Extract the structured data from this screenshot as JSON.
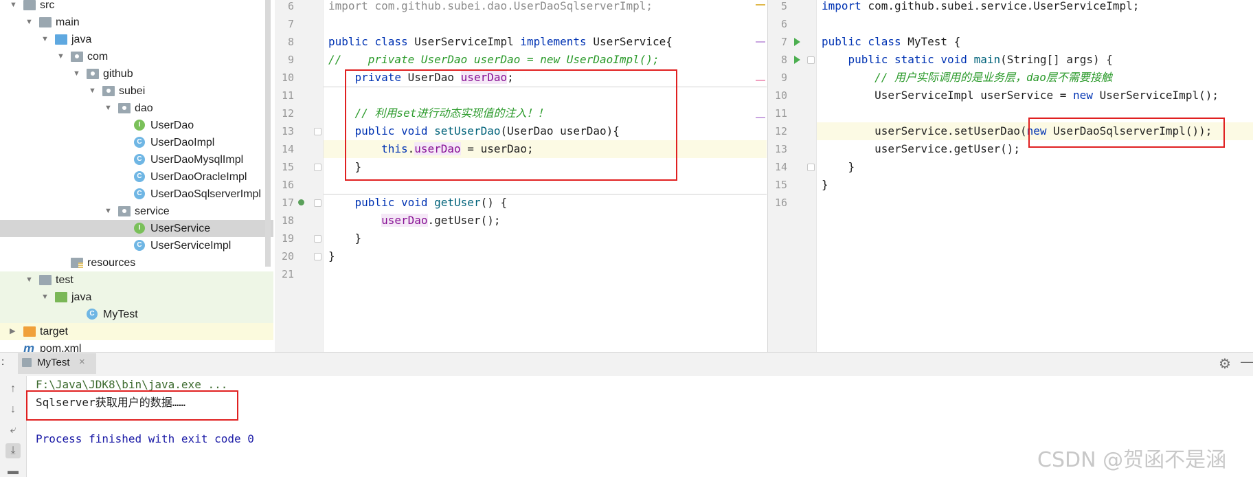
{
  "project_tree": {
    "items": [
      {
        "label": "src",
        "depth": 0,
        "icon": "folder-gray",
        "arrow": "expanded"
      },
      {
        "label": "main",
        "depth": 1,
        "icon": "folder-gray",
        "arrow": "expanded"
      },
      {
        "label": "java",
        "depth": 2,
        "icon": "folder-blue",
        "arrow": "expanded"
      },
      {
        "label": "com",
        "depth": 3,
        "icon": "folder-pkg",
        "arrow": "expanded"
      },
      {
        "label": "github",
        "depth": 4,
        "icon": "folder-pkg",
        "arrow": "expanded"
      },
      {
        "label": "subei",
        "depth": 5,
        "icon": "folder-pkg",
        "arrow": "expanded"
      },
      {
        "label": "dao",
        "depth": 6,
        "icon": "folder-pkg",
        "arrow": "expanded"
      },
      {
        "label": "UserDao",
        "depth": 7,
        "icon": "interface-icon",
        "badge": "I"
      },
      {
        "label": "UserDaoImpl",
        "depth": 7,
        "icon": "class-icon",
        "badge": "C"
      },
      {
        "label": "UserDaoMysqlImpl",
        "depth": 7,
        "icon": "class-icon",
        "badge": "C"
      },
      {
        "label": "UserDaoOracleImpl",
        "depth": 7,
        "icon": "class-icon",
        "badge": "C"
      },
      {
        "label": "UserDaoSqlserverImpl",
        "depth": 7,
        "icon": "class-icon",
        "badge": "C"
      },
      {
        "label": "service",
        "depth": 6,
        "icon": "folder-pkg",
        "arrow": "expanded"
      },
      {
        "label": "UserService",
        "depth": 7,
        "icon": "interface-icon",
        "badge": "I",
        "selected": true
      },
      {
        "label": "UserServiceImpl",
        "depth": 7,
        "icon": "class-icon",
        "badge": "C"
      },
      {
        "label": "resources",
        "depth": 3,
        "icon": "folder-res"
      },
      {
        "label": "test",
        "depth": 1,
        "icon": "folder-gray",
        "arrow": "expanded"
      },
      {
        "label": "java",
        "depth": 2,
        "icon": "folder-green",
        "arrow": "expanded"
      },
      {
        "label": "MyTest",
        "depth": 4,
        "icon": "test-class-icon",
        "badge": "C"
      },
      {
        "label": "target",
        "depth": 0,
        "icon": "folder-orange",
        "arrow": "collapsed"
      },
      {
        "label": "pom.xml",
        "depth": 0,
        "icon": "maven-icon",
        "badge": "m"
      }
    ]
  },
  "left_editor": {
    "lines": [
      {
        "n": "6",
        "html": "<span class=\"cm\">import com.github.subei.dao.UserDaoSqlserverImpl;</span>"
      },
      {
        "n": "7",
        "html": ""
      },
      {
        "n": "8",
        "html": "<span class=\"kw\">public class</span> UserServiceImpl <span class=\"kw\">implements</span> UserService{"
      },
      {
        "n": "9",
        "html": "<span class=\"gcm\">//    private UserDao userDao = new UserDaoImpl();</span>"
      },
      {
        "n": "10",
        "html": "    <span class=\"kw\">private</span> UserDao <span class=\"fld\">userDao</span>;"
      },
      {
        "n": "11",
        "html": ""
      },
      {
        "n": "12",
        "html": "    <span class=\"gcm\">// 利用set进行动态实现值的注入！！</span>"
      },
      {
        "n": "13",
        "html": "    <span class=\"kw\">public void</span> <span class=\"mth\">setUserDao</span>(UserDao userDao){"
      },
      {
        "n": "14",
        "html": "        <span class=\"kw\">this</span>.<span class=\"fld\">userDao</span> = userDao;"
      },
      {
        "n": "15",
        "html": "    }"
      },
      {
        "n": "16",
        "html": ""
      },
      {
        "n": "17",
        "html": "    <span class=\"kw\">public void</span> <span class=\"mth\">getUser</span>() {"
      },
      {
        "n": "18",
        "html": "        <span class=\"fld\">userDao</span>.getUser();"
      },
      {
        "n": "19",
        "html": "    }"
      },
      {
        "n": "20",
        "html": "}"
      },
      {
        "n": "21",
        "html": ""
      }
    ]
  },
  "right_editor": {
    "lines": [
      {
        "n": "5",
        "html": "<span class=\"kw\">import</span> com.github.subei.service.UserServiceImpl;"
      },
      {
        "n": "6",
        "html": ""
      },
      {
        "n": "7",
        "html": "<span class=\"kw\">public class</span> MyTest {"
      },
      {
        "n": "8",
        "html": "    <span class=\"kw\">public static void</span> <span class=\"mth\">main</span>(String[] args) {"
      },
      {
        "n": "9",
        "html": "        <span class=\"gcm\">// 用户实际调用的是业务层，dao层不需要接触</span>"
      },
      {
        "n": "10",
        "html": "        UserServiceImpl userService = <span class=\"kw\">new</span> UserServiceImpl();"
      },
      {
        "n": "11",
        "html": ""
      },
      {
        "n": "12",
        "html": "        userService.setUserDao(<span class=\"kw\">new</span> UserDaoSqlserverImpl());"
      },
      {
        "n": "13",
        "html": "        userService.getUser();"
      },
      {
        "n": "14",
        "html": "    }"
      },
      {
        "n": "15",
        "html": "}"
      },
      {
        "n": "16",
        "html": ""
      }
    ]
  },
  "run_panel": {
    "prefix": ":",
    "tab_label": "MyTest",
    "tab_close": "×",
    "command_line": "F:\\Java\\JDK8\\bin\\java.exe ...",
    "output_line": "Sqlserver获取用户的数据……",
    "exit_line": "Process finished with exit code 0",
    "settings_icon": "⚙",
    "minimize_icon": "—"
  },
  "watermark": "CSDN @贺函不是涵",
  "colors": {
    "keyword": "#0033b3",
    "comment_green": "#2a9a2a",
    "field": "#871094",
    "method": "#00627a",
    "highlight_box": "#e02020",
    "exit_text": "#1a1aa6",
    "command_text": "#3d6b2f"
  }
}
